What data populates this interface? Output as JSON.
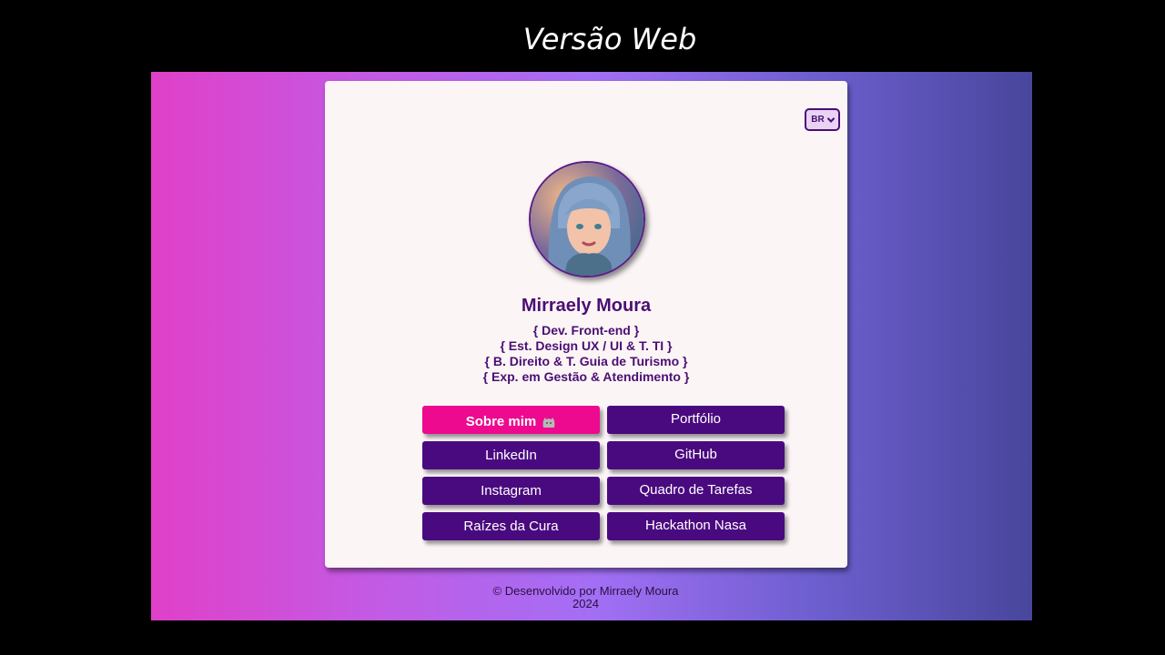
{
  "slide": {
    "title": "Versão Web"
  },
  "language": {
    "selected": "BR"
  },
  "profile": {
    "name": "Mirraely Moura",
    "roles": [
      "{ Dev. Front-end }",
      "{ Est. Design UX / UI & T. TI }",
      "{ B. Direito & T. Guia de Turismo }",
      "{ Exp. em Gestão & Atendimento }"
    ]
  },
  "buttons": {
    "about": "Sobre mim",
    "portfolio": "Portfólio",
    "linkedin": "LinkedIn",
    "github": "GitHub",
    "instagram": "Instagram",
    "tasks": "Quadro de Tarefas",
    "raizes": "Raízes da Cura",
    "hackathon": "Hackathon Nasa"
  },
  "icons": {
    "about": "octocat-icon"
  },
  "footer": {
    "credit": "© Desenvolvido por Mirraely Moura",
    "year": "2024"
  },
  "colors": {
    "primary": "#4a0a7f",
    "active": "#ed0a8f",
    "card": "#fcf5f6",
    "gradient_start": "#e040c8",
    "gradient_end": "#48469c"
  }
}
